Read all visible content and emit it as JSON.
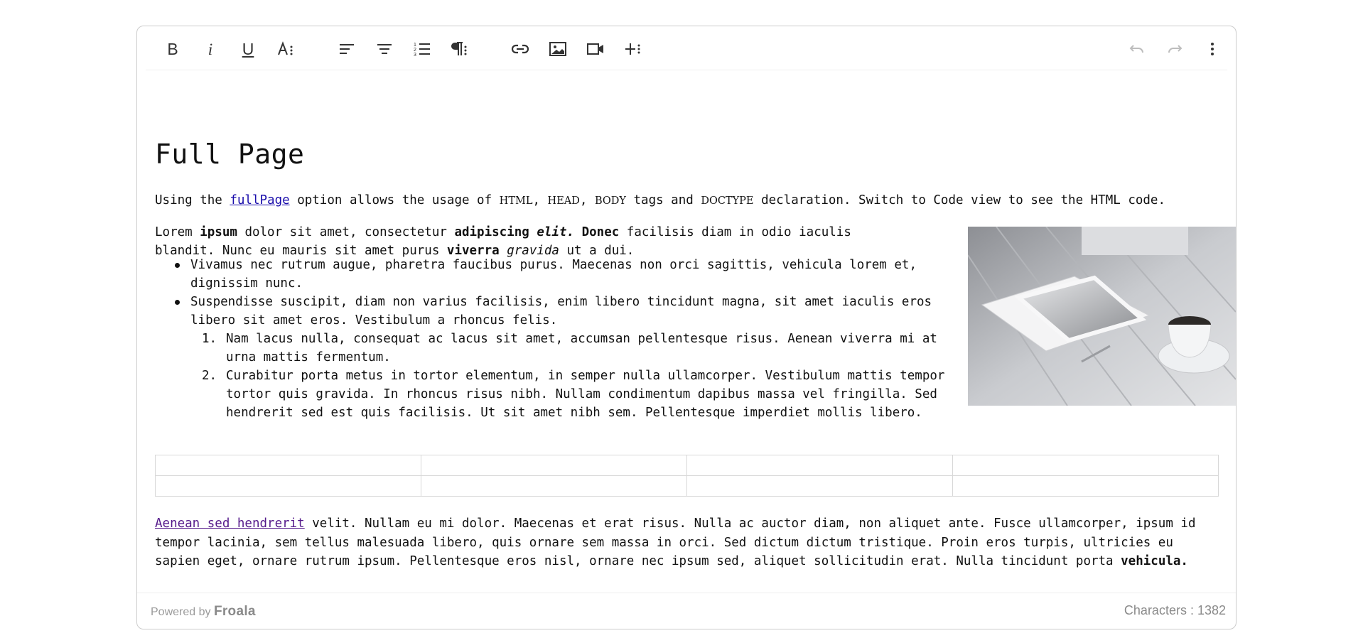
{
  "toolbar": {
    "left_groups": [
      [
        "bold",
        "italic",
        "underline",
        "text-format"
      ],
      [
        "align-left",
        "align-center",
        "ordered-list",
        "paragraph-format"
      ],
      [
        "insert-link",
        "insert-image",
        "insert-video",
        "insert-more"
      ]
    ],
    "right": [
      "undo",
      "redo",
      "more-options"
    ],
    "bold_label": "B",
    "italic_label": "i",
    "underline_label": "U"
  },
  "content": {
    "title": "Full Page",
    "intro": {
      "before": "Using the ",
      "link": "fullPage",
      "after1": " option allows the usage of ",
      "tag_html": "HTML",
      "sep1": ", ",
      "tag_head": "HEAD",
      "sep2": ", ",
      "tag_body": "BODY",
      "after2": " tags and ",
      "tag_doctype": "DOCTYPE",
      "after3": " declaration. Switch to Code view to see the HTML code."
    },
    "lorem": {
      "t1": "Lorem ",
      "b1": "ipsum",
      "t2": " dolor sit amet, consectetur ",
      "b2": "adipiscing ",
      "bi1": "elit.",
      "b3": " Donec",
      "t3": " facilisis diam in odio iaculis blandit. Nunc eu mauris sit amet purus ",
      "b4": "viverra",
      "t4": " ",
      "i1": "gravida",
      "t5": " ut a dui."
    },
    "bullets": [
      "Vivamus nec rutrum augue, pharetra faucibus purus. Maecenas non orci sagittis, vehicula lorem et, dignissim nunc.",
      "Suspendisse suscipit, diam non varius facilisis, enim libero tincidunt magna, sit amet iaculis eros libero sit amet eros. Vestibulum a rhoncus felis."
    ],
    "numbered": [
      {
        "num": "1.",
        "text": "Nam lacus nulla, consequat ac lacus sit amet, accumsan pellentesque risus. Aenean viverra mi at urna mattis fermentum."
      },
      {
        "num": "2.",
        "text": "Curabitur porta metus in tortor elementum, in semper nulla ullamcorper. Vestibulum mattis tempor tortor quis gravida. In rhoncus risus nibh. Nullam condimentum dapibus massa vel fringilla. Sed hendrerit sed est quis facilisis. Ut sit amet nibh sem. Pellentesque imperdiet mollis libero."
      }
    ],
    "table": {
      "rows": 2,
      "cols": 4
    },
    "last": {
      "link": "Aenean sed hendrerit",
      "text": " velit. Nullam eu mi dolor. Maecenas et erat risus. Nulla ac auctor diam, non aliquet ante. Fusce ullamcorper, ipsum id tempor lacinia, sem tellus malesuada libero, quis ornare sem massa in orci. Sed dictum dictum tristique. Proin eros turpis, ultricies eu sapien eget, ornare rutrum ipsum. Pellentesque eros nisl, ornare nec ipsum sed, aliquet sollicitudin erat. Nulla tincidunt porta ",
      "bold_end": "vehicula."
    }
  },
  "footer": {
    "powered_by": "Powered by",
    "brand": "Froala",
    "char_count": "Characters : 1382"
  },
  "colors": {
    "link": "#1a0dab",
    "visited_link": "#551a8b",
    "border": "#cccccc",
    "disabled_icon": "#bdbdbd"
  }
}
